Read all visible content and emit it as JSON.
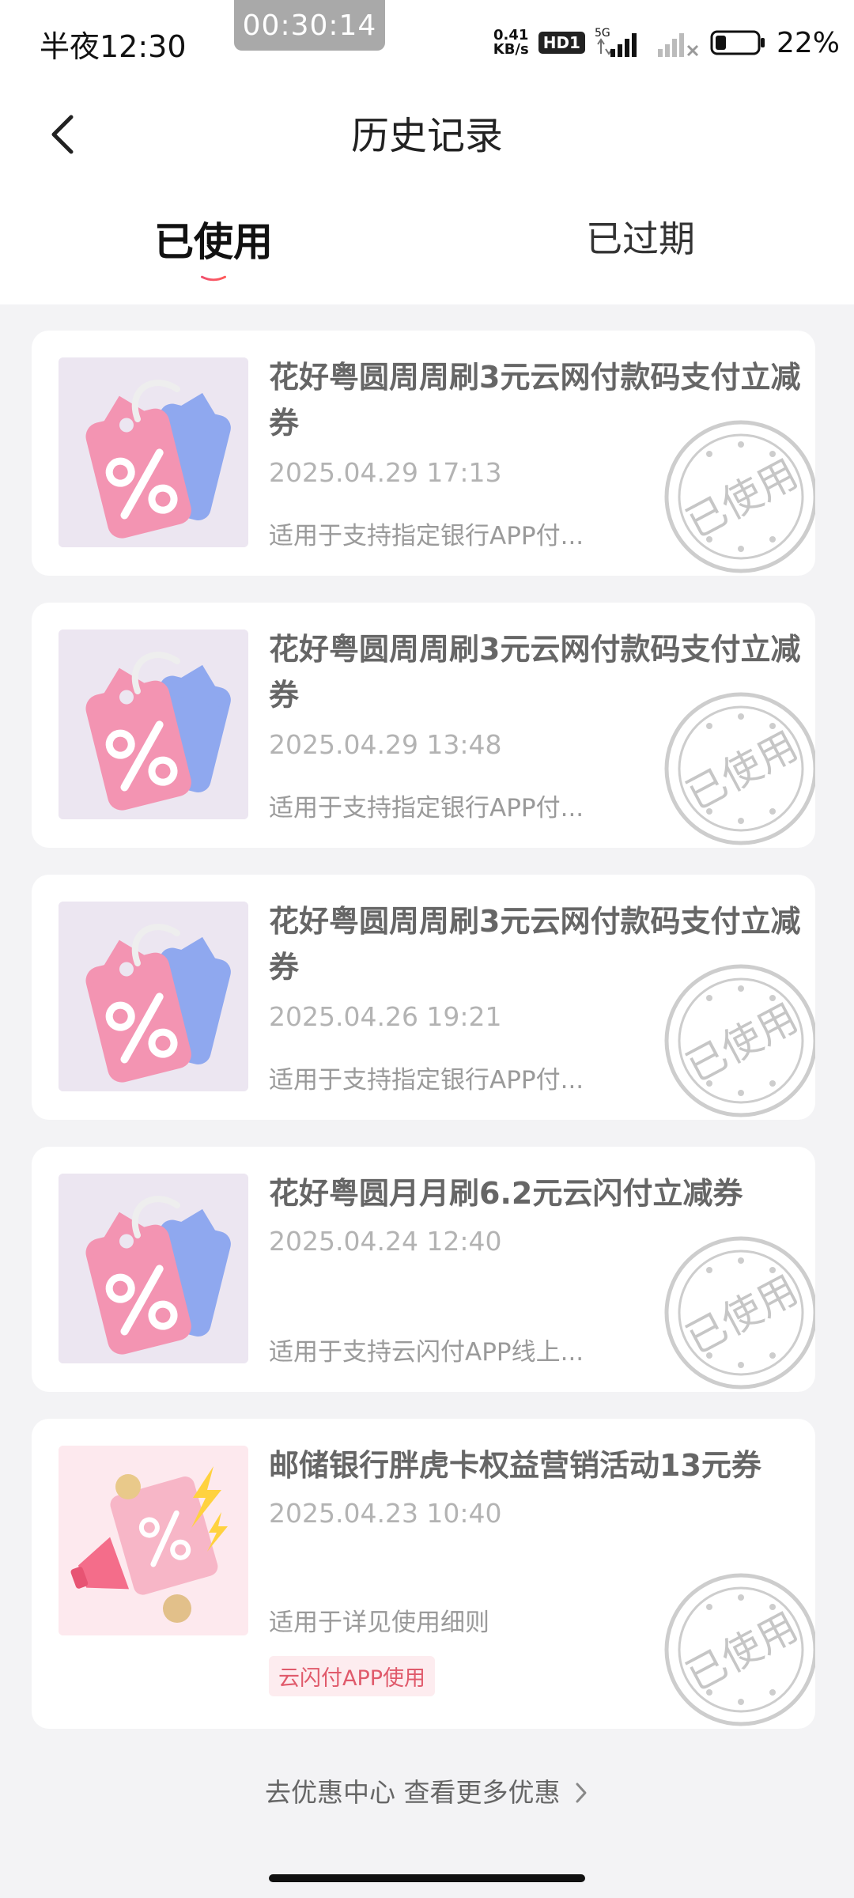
{
  "status": {
    "time": "半夜12:30",
    "recording": "00:30:14",
    "net_speed_value": "0.41",
    "net_speed_unit": "KB/s",
    "hd": "HD1",
    "network": "5G",
    "battery": "22%"
  },
  "header": {
    "title": "历史记录"
  },
  "tabs": [
    {
      "label": "已使用",
      "active": true
    },
    {
      "label": "已过期",
      "active": false
    }
  ],
  "coupons": [
    {
      "title": "花好粤圆周周刷3元云网付款码支付立减券",
      "time": "2025.04.29 17:13",
      "desc": "适用于支持指定银行APP付...",
      "stamp": "已使用"
    },
    {
      "title": "花好粤圆周周刷3元云网付款码支付立减券",
      "time": "2025.04.29 13:48",
      "desc": "适用于支持指定银行APP付...",
      "stamp": "已使用"
    },
    {
      "title": "花好粤圆周周刷3元云网付款码支付立减券",
      "time": "2025.04.26 19:21",
      "desc": "适用于支持指定银行APP付...",
      "stamp": "已使用"
    },
    {
      "title": "花好粤圆月月刷6.2元云闪付立减券",
      "time": "2025.04.24 12:40",
      "desc": "适用于支持云闪付APP线上...",
      "stamp": "已使用"
    },
    {
      "title": "邮储银行胖虎卡权益营销活动13元券",
      "time": "2025.04.23 10:40",
      "desc": "适用于详见使用细则",
      "tag": "云闪付APP使用",
      "stamp": "已使用"
    }
  ],
  "footer": {
    "link": "去优惠中心 查看更多优惠"
  },
  "colors": {
    "accent": "#e8465c",
    "tab_underline_start": "#f0506e",
    "tab_underline_end": "#ff7a45"
  }
}
